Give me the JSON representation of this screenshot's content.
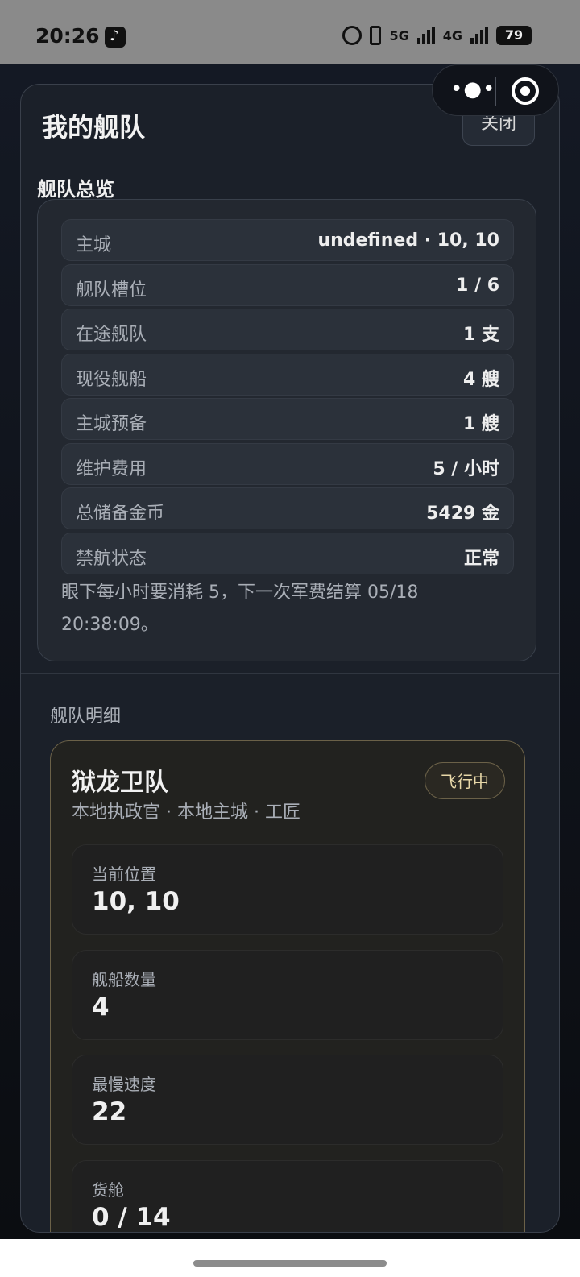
{
  "status_bar": {
    "time": "20:26",
    "network_5g": "5G",
    "network_4g": "4G",
    "battery": "79"
  },
  "panel": {
    "title": "我的舰队",
    "close_label": "关闭",
    "overview_title": "舰队总览",
    "stats": [
      {
        "label": "主城",
        "value": "undefined · 10, 10"
      },
      {
        "label": "舰队槽位",
        "value": "1 / 6"
      },
      {
        "label": "在途舰队",
        "value": "1 支"
      },
      {
        "label": "现役舰船",
        "value": "4 艘"
      },
      {
        "label": "主城预备",
        "value": "1 艘"
      },
      {
        "label": "维护费用",
        "value": "5 / 小时"
      },
      {
        "label": "总储备金币",
        "value": "5429 金"
      },
      {
        "label": "禁航状态",
        "value": "正常"
      }
    ],
    "note": "眼下每小时要消耗 5，下一次军费结算 05/18 20:38:09。",
    "detail_heading": "舰队明细"
  },
  "fleet": {
    "name": "狱龙卫队",
    "subtitle": "本地执政官 · 本地主城 · 工匠",
    "status": "飞行中",
    "info": [
      {
        "label": "当前位置",
        "value": "10, 10"
      },
      {
        "label": "舰船数量",
        "value": "4"
      },
      {
        "label": "最慢速度",
        "value": "22"
      },
      {
        "label": "货舱",
        "value": "0 / 14"
      }
    ]
  }
}
